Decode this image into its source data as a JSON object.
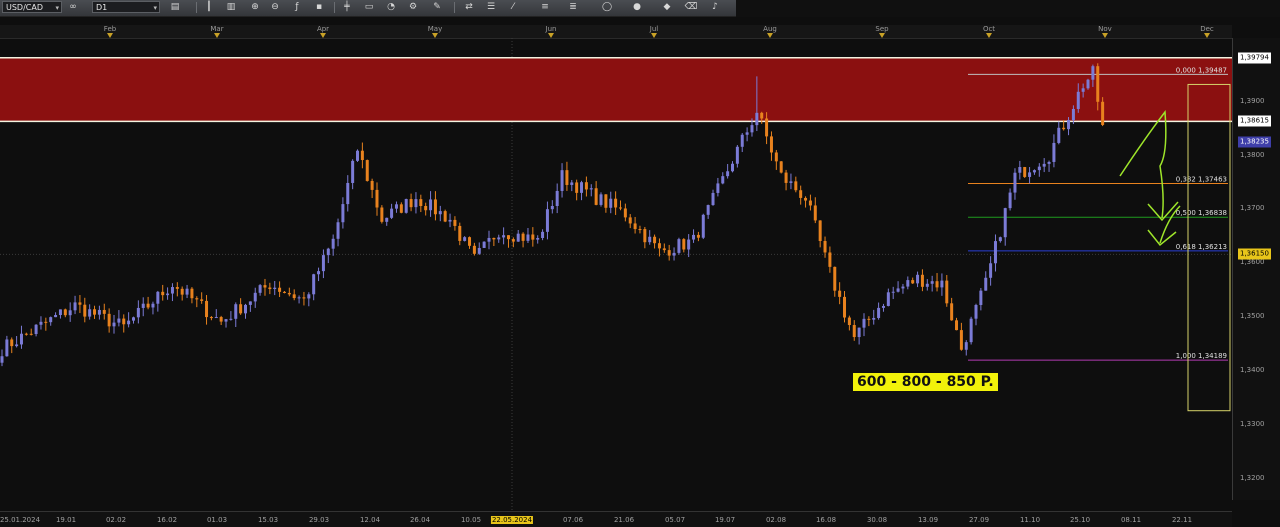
{
  "toolbar": {
    "symbol": "USD/CAD",
    "timeframe": "D1",
    "icons": [
      "chain-icon",
      "chart-type-icon",
      "bar-chart-icon",
      "candles-icon",
      "zoom-in-icon",
      "zoom-out-icon",
      "indicator-icon",
      "crosshair-icon",
      "note-icon",
      "template-icon",
      "gear-icon",
      "pencil-icon",
      "script-icon",
      "template-icon",
      "trendline-icon",
      "channel-icon",
      "ellipse-icon",
      "circle-icon",
      "tag-icon",
      "eraser-icon"
    ]
  },
  "colors": {
    "bull": "#7b7bd6",
    "bear": "#e8821e",
    "zone": "#8b1010",
    "zone_line": "#f3f3e0",
    "fib_0": "#bfbfbf",
    "fib_382": "#e8821e",
    "fib_50": "#1f9a1f",
    "fib_618": "#2a3fd6",
    "fib_100": "#b23bb2",
    "arrow": "#9ee52a",
    "highlight": "#f2f20a"
  },
  "chart_data": {
    "type": "candlestick",
    "symbol": "USD/CAD",
    "timeframe": "D1",
    "ylim": [
      1.3145,
      1.399
    ],
    "y_ticks": [
      "1,3900",
      "1,3800",
      "1,3700",
      "1,3600",
      "1,3500",
      "1,3400",
      "1,3300",
      "1,3200"
    ],
    "months": [
      "Feb",
      "Mar",
      "Apr",
      "May",
      "Jun",
      "Jul",
      "Aug",
      "Sep",
      "Oct",
      "Nov",
      "Dec"
    ],
    "dates": [
      "25.01.2024",
      "19.01",
      "02.02",
      "16.02",
      "01.03",
      "15.03",
      "29.03",
      "12.04",
      "26.04",
      "10.05",
      "22.05.2024",
      "07.06",
      "21.06",
      "05.07",
      "19.07",
      "02.08",
      "16.08",
      "30.08",
      "13.09",
      "27.09",
      "11.10",
      "25.10",
      "08.11",
      "22.11"
    ],
    "highlighted_date": "22.05.2024",
    "price_labels": [
      {
        "text": "1,39794",
        "bg": "#ffffff",
        "fg": "#000000"
      },
      {
        "text": "1,38615",
        "bg": "#ffffff",
        "fg": "#000000"
      },
      {
        "text": "1,38235",
        "bg": "#3f3faa",
        "fg": "#ffffff"
      },
      {
        "text": "1,36150",
        "bg": "#e8c51a",
        "fg": "#000000"
      }
    ],
    "resistance_zone": {
      "top": 1.39794,
      "bottom": 1.38615
    },
    "fibonacci": [
      {
        "level": "0,000",
        "price": "1,39487"
      },
      {
        "level": "0,382",
        "price": "1,37463"
      },
      {
        "level": "0,500",
        "price": "1,36838"
      },
      {
        "level": "0,618",
        "price": "1,36213"
      },
      {
        "level": "1,000",
        "price": "1,34189"
      }
    ],
    "anchors": [
      {
        "i": 0,
        "close": 1.344
      },
      {
        "i": 15,
        "close": 1.352
      },
      {
        "i": 25,
        "close": 1.348
      },
      {
        "i": 35,
        "close": 1.356
      },
      {
        "i": 45,
        "close": 1.349
      },
      {
        "i": 55,
        "close": 1.356
      },
      {
        "i": 62,
        "close": 1.353
      },
      {
        "i": 68,
        "close": 1.364
      },
      {
        "i": 73,
        "close": 1.381
      },
      {
        "i": 78,
        "close": 1.368
      },
      {
        "i": 85,
        "close": 1.372
      },
      {
        "i": 92,
        "close": 1.368
      },
      {
        "i": 97,
        "close": 1.3605
      },
      {
        "i": 102,
        "close": 1.366
      },
      {
        "i": 110,
        "close": 1.364
      },
      {
        "i": 115,
        "close": 1.376
      },
      {
        "i": 122,
        "close": 1.372
      },
      {
        "i": 128,
        "close": 1.369
      },
      {
        "i": 135,
        "close": 1.362
      },
      {
        "i": 142,
        "close": 1.364
      },
      {
        "i": 150,
        "close": 1.379
      },
      {
        "i": 155,
        "close": 1.388
      },
      {
        "i": 160,
        "close": 1.376
      },
      {
        "i": 165,
        "close": 1.372
      },
      {
        "i": 170,
        "close": 1.358
      },
      {
        "i": 175,
        "close": 1.346
      },
      {
        "i": 182,
        "close": 1.354
      },
      {
        "i": 188,
        "close": 1.357
      },
      {
        "i": 193,
        "close": 1.356
      },
      {
        "i": 197,
        "close": 1.344
      },
      {
        "i": 202,
        "close": 1.356
      },
      {
        "i": 208,
        "close": 1.376
      },
      {
        "i": 215,
        "close": 1.38
      },
      {
        "i": 222,
        "close": 1.393
      },
      {
        "i": 224,
        "close": 1.395
      },
      {
        "i": 226,
        "close": 1.385
      }
    ],
    "annotation": "600 - 800 - 850 P."
  }
}
